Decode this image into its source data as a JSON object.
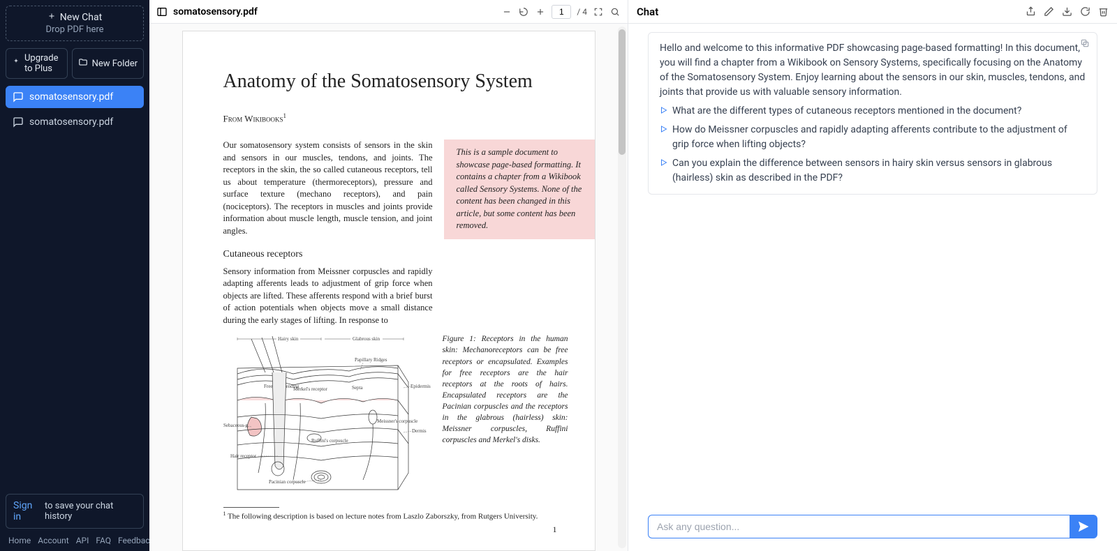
{
  "sidebar": {
    "new_chat_label": "New Chat",
    "drop_hint": "Drop PDF here",
    "upgrade_label": "Upgrade to Plus",
    "new_folder_label": "New Folder",
    "chats": [
      {
        "name": "somatosensory.pdf",
        "active": true
      },
      {
        "name": "somatosensory.pdf",
        "active": false
      }
    ],
    "signin_label": "Sign in",
    "signin_tail": "to save your chat history",
    "footer": [
      "Home",
      "Account",
      "API",
      "FAQ",
      "Feedback"
    ]
  },
  "doc": {
    "filename": "somatosensory.pdf",
    "page_current": "1",
    "page_total": "/ 4",
    "page_number_printed": "1",
    "title": "Anatomy of the Somatosensory System",
    "subtitle_a": "From Wikibooks",
    "subtitle_sup": "1",
    "para1": "Our somatosensory system consists of sensors in the skin and sensors in our muscles, tendons, and joints. The receptors in the skin, the so called cutaneous receptors, tell us about temperature (thermoreceptors), pressure and surface texture (mechano receptors), and pain (nociceptors). The receptors in muscles and joints provide information about muscle length, muscle tension, and joint angles.",
    "note": "This is a sample document to showcase page-based formatting. It contains a chapter from a Wikibook called Sensory Systems. None of the content has been changed in this article, but some content has been removed.",
    "section_h": "Cutaneous receptors",
    "para2": "Sensory information from Meissner corpuscles and rapidly adapting afferents leads to adjustment of grip force when objects are lifted. These afferents respond with a brief burst of action potentials when objects move a small distance during the early stages of lifting. In response to",
    "fig_labels": {
      "hairy": "Hairy skin",
      "glabrous": "Glabrous skin",
      "papillary": "Papillary Ridges",
      "free_nerve": "Free nerve ending",
      "merkel": "Merkel's receptor",
      "septa": "Septa",
      "epidermis": "Epidermis",
      "meissner": "Meissner's corpuscle",
      "dermis": "Dermis",
      "sebaceous": "Sebaceous gland",
      "ruffini": "Ruffini's corpuscle",
      "hair_receptor": "Hair receptor",
      "pacinian": "Pacinian corpuscle"
    },
    "caption": "Figure 1:  Receptors in the human skin: Mechanoreceptors can be free receptors or encapsulated. Examples for free receptors are the hair receptors at the roots of hairs. Encapsulated receptors are the Pacinian corpuscles and the receptors in the glabrous (hairless) skin: Meissner corpuscles, Ruffini corpuscles and Merkel's disks.",
    "footnote": "The following description is based on lecture notes from Laszlo Zaborszky, from Rutgers University.",
    "footnote_sup": "1"
  },
  "chat": {
    "header": "Chat",
    "welcome": "Hello and welcome to this informative PDF showcasing page-based formatting! In this document, you will find a chapter from a Wikibook on Sensory Systems, specifically focusing on the Anatomy of the Somatosensory System. Enjoy learning about the sensors in our skin, muscles, tendons, and joints that provide us with valuable sensory information.",
    "suggestions": [
      "What are the different types of cutaneous receptors mentioned in the document?",
      "How do Meissner corpuscles and rapidly adapting afferents contribute to the adjustment of grip force when lifting objects?",
      "Can you explain the difference between sensors in hairy skin versus sensors in glabrous (hairless) skin as described in the PDF?"
    ],
    "input_placeholder": "Ask any question..."
  },
  "icons": {
    "plus": "plus-icon",
    "sparkle": "sparkle-icon",
    "folder": "folder-plus-icon",
    "chat_bubble": "chat-bubble-icon",
    "sidebar_toggle": "panel-left-icon",
    "zoom_out": "minus-icon",
    "rotate": "rotate-ccw-icon",
    "zoom_in": "plus-icon",
    "fit": "maximize-icon",
    "search": "search-icon",
    "share": "share-icon",
    "edit": "pencil-icon",
    "download": "download-icon",
    "refresh": "refresh-icon",
    "trash": "trash-icon",
    "copy": "clipboard-icon",
    "send": "send-icon",
    "play": "play-icon"
  }
}
